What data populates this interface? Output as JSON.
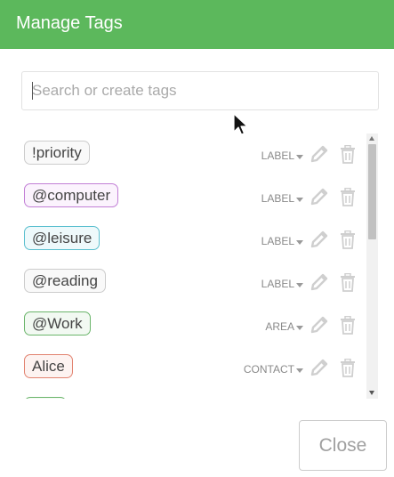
{
  "header": {
    "title": "Manage Tags",
    "color": "#5cb85c"
  },
  "search": {
    "placeholder": "Search or create tags",
    "value": ""
  },
  "tags": [
    {
      "name": "!priority",
      "type": "LABEL",
      "border": "#cccccc",
      "bg": "#f9f9f9"
    },
    {
      "name": "@computer",
      "type": "LABEL",
      "border": "#c27fd6",
      "bg": "#fbf3fd"
    },
    {
      "name": "@leisure",
      "type": "LABEL",
      "border": "#5bbfcf",
      "bg": "#eef9fb"
    },
    {
      "name": "@reading",
      "type": "LABEL",
      "border": "#cccccc",
      "bg": "#f9f9f9"
    },
    {
      "name": "@Work",
      "type": "AREA",
      "border": "#6bb56b",
      "bg": "#f2f9f2"
    },
    {
      "name": "Alice",
      "type": "CONTACT",
      "border": "#e2826f",
      "bg": "#fdf3f1"
    }
  ],
  "footer": {
    "close_label": "Close"
  }
}
